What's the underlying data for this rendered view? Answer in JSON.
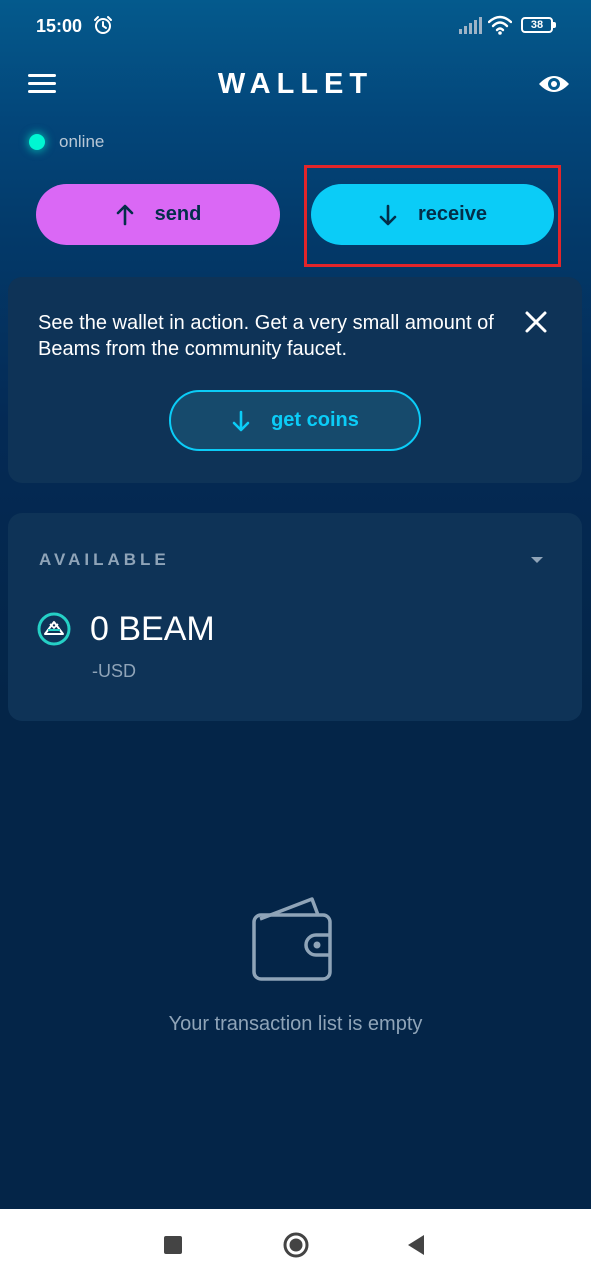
{
  "status_bar": {
    "time": "15:00",
    "battery": "38",
    "icons": [
      "alarm-icon",
      "signal-icon",
      "wifi-icon",
      "battery-icon"
    ]
  },
  "header": {
    "title": "WALLET",
    "menu_icon": "hamburger-menu-icon",
    "privacy_icon": "eye-icon"
  },
  "connection": {
    "status": "online",
    "color": "#00f6d2"
  },
  "actions": {
    "send_label": "send",
    "receive_label": "receive",
    "send_color": "#da68f5",
    "receive_color": "#0bccf7"
  },
  "faucet": {
    "message": "See the wallet in action. Get a very small amount of Beams from the community faucet.",
    "button_label": "get coins"
  },
  "balance": {
    "label": "AVAILABLE",
    "amount": "0 BEAM",
    "fiat": "-USD",
    "currency_icon": "beam-logo-icon"
  },
  "transactions": {
    "empty_message": "Your transaction list is empty",
    "empty_icon": "wallet-icon"
  },
  "highlight": {
    "target": "receive",
    "color": "#e3252a"
  },
  "navbar": {
    "icons": [
      "recent-apps-icon",
      "home-icon",
      "back-icon"
    ]
  }
}
